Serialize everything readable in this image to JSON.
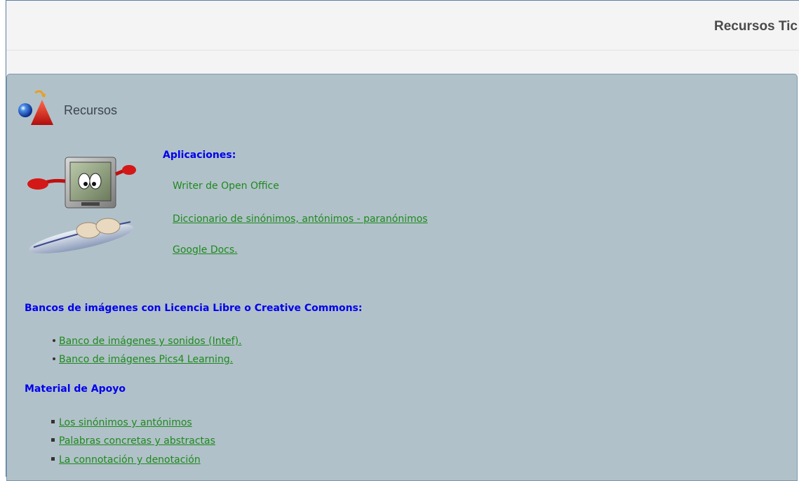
{
  "header": {
    "title": "Recursos Tic"
  },
  "section": {
    "title": "Recursos",
    "icon": "shapes-logo-icon"
  },
  "mascot": {
    "icon": "computer-mascot-surfboard-icon"
  },
  "aplicaciones": {
    "heading": "Aplicaciones:",
    "items": [
      {
        "label": "Writer de Open Office",
        "is_link": false
      },
      {
        "label": "Diccionario de sinónimos, antónimos - paranónimos",
        "is_link": true
      },
      {
        "label": "Google Docs.",
        "is_link": true
      }
    ]
  },
  "bancos": {
    "heading": "Bancos de imágenes con Licencia Libre o Creative Commons:",
    "items": [
      {
        "label": "Banco de imágenes y sonidos (Intef)."
      },
      {
        "label": "Banco de imágenes Pics4 Learning."
      }
    ]
  },
  "material": {
    "heading": "Material de Apoyo",
    "items": [
      {
        "label": "Los sinónimos y antónimos"
      },
      {
        "label": "Palabras concretas y abstractas"
      },
      {
        "label": "La connotación y denotación"
      }
    ]
  },
  "colors": {
    "panel_bg": "#b1c1c9",
    "heading_blue": "#0000ee",
    "link_green": "#1d8a1d",
    "title_gray": "#4a4a4a"
  }
}
